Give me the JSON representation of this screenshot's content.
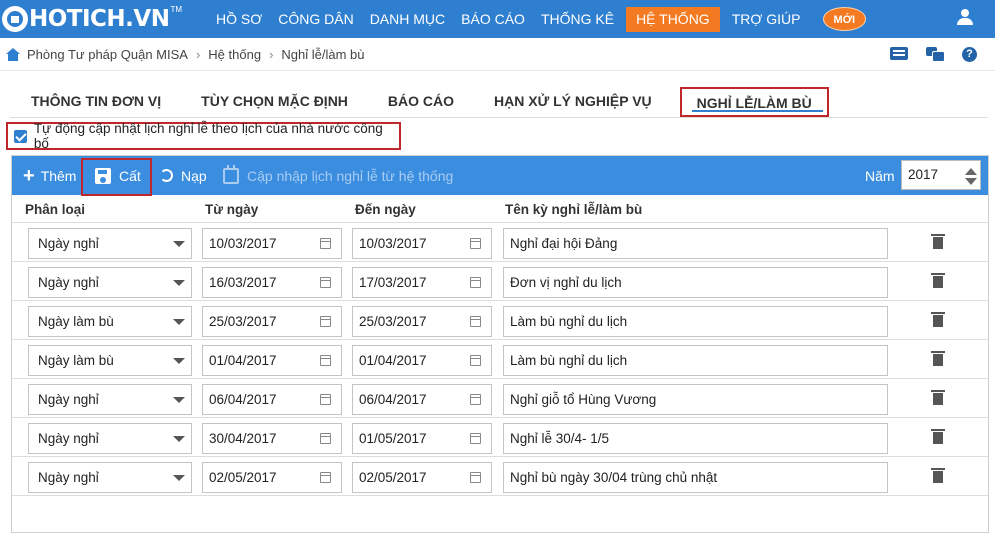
{
  "app": {
    "logo_text": "HOTICH.VN",
    "logo_tm": "TM"
  },
  "nav": {
    "items": [
      {
        "label": "Hồ sơ"
      },
      {
        "label": "Công dân"
      },
      {
        "label": "Danh mục"
      },
      {
        "label": "Báo cáo"
      },
      {
        "label": "Thống kê"
      },
      {
        "label": "Hệ thống"
      },
      {
        "label": "Trợ giúp"
      }
    ],
    "active_index": 5,
    "new_badge": "MỚI"
  },
  "breadcrumb": {
    "items": [
      "Phòng Tư pháp Quận MISA",
      "Hệ thống",
      "Nghỉ lễ/làm bù"
    ],
    "separator": "›"
  },
  "icons": {
    "help": "?"
  },
  "tabs": [
    {
      "label": "Thông tin đơn vị"
    },
    {
      "label": "Tùy chọn mặc định"
    },
    {
      "label": "Báo cáo"
    },
    {
      "label": "Hạn xử lý nghiệp vụ"
    },
    {
      "label": "Nghỉ lễ/làm bù"
    }
  ],
  "auto_update": {
    "checked": true,
    "label": "Tự động cập nhật lịch nghỉ lễ theo lịch của nhà nước công bố"
  },
  "toolbar": {
    "add": "Thêm",
    "save": "Cất",
    "reload": "Nạp",
    "sync": "Cập nhập lịch nghỉ lễ từ hệ thống",
    "year_label": "Năm",
    "year_value": "2017"
  },
  "columns": {
    "type": "Phân loại",
    "from": "Từ ngày",
    "to": "Đến ngày",
    "name": "Tên kỳ nghỉ lễ/làm bù"
  },
  "rows": [
    {
      "type": "Ngày nghỉ",
      "from": "10/03/2017",
      "to": "10/03/2017",
      "name": "Nghỉ đại hội Đảng"
    },
    {
      "type": "Ngày nghỉ",
      "from": "16/03/2017",
      "to": "17/03/2017",
      "name": "Đơn vị nghỉ du lịch"
    },
    {
      "type": "Ngày làm bù",
      "from": "25/03/2017",
      "to": "25/03/2017",
      "name": "Làm bù nghỉ du lịch"
    },
    {
      "type": "Ngày làm bù",
      "from": "01/04/2017",
      "to": "01/04/2017",
      "name": "Làm bù nghỉ du lịch"
    },
    {
      "type": "Ngày nghỉ",
      "from": "06/04/2017",
      "to": "06/04/2017",
      "name": "Nghỉ giỗ tổ Hùng Vương"
    },
    {
      "type": "Ngày nghỉ",
      "from": "30/04/2017",
      "to": "01/05/2017",
      "name": "Nghỉ lễ 30/4- 1/5"
    },
    {
      "type": "Ngày nghỉ",
      "from": "02/05/2017",
      "to": "02/05/2017",
      "name": "Nghỉ bù ngày 30/04 trùng chủ nhật"
    }
  ],
  "colors": {
    "topbar": "#2f7fd1",
    "toolbar": "#3b8de0",
    "accent_orange": "#f47a21",
    "highlight_red": "#c0272d"
  }
}
